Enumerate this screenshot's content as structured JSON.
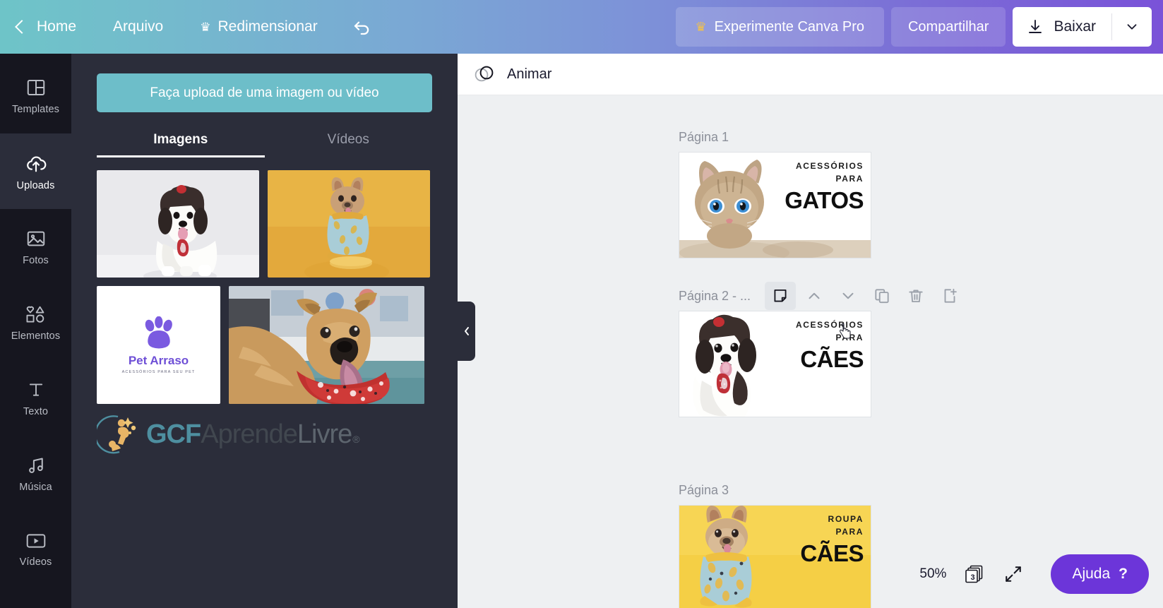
{
  "topbar": {
    "back_icon": "chevron-left-icon",
    "home_label": "Home",
    "file_label": "Arquivo",
    "resize_label": "Redimensionar",
    "resize_crown_icon": "crown-icon",
    "undo_icon": "undo-arrow-icon",
    "pro_label": "Experimente Canva Pro",
    "pro_crown_icon": "crown-icon",
    "share_label": "Compartilhar",
    "download_label": "Baixar",
    "download_icon": "download-arrow-icon",
    "download_caret_icon": "chevron-down-icon",
    "gradient_start": "#6ec4c8",
    "gradient_end": "#7a52d8"
  },
  "rail": {
    "items": [
      {
        "label": "Templates",
        "icon": "templates-grid-icon",
        "active": false
      },
      {
        "label": "Uploads",
        "icon": "cloud-upload-icon",
        "active": true
      },
      {
        "label": "Fotos",
        "icon": "photo-mountain-icon",
        "active": false
      },
      {
        "label": "Elementos",
        "icon": "shapes-icon",
        "active": false
      },
      {
        "label": "Texto",
        "icon": "text-t-icon",
        "active": false
      },
      {
        "label": "Música",
        "icon": "music-note-icon",
        "active": false
      },
      {
        "label": "Vídeos",
        "icon": "video-play-icon",
        "active": false
      }
    ]
  },
  "panel": {
    "upload_button_label": "Faça upload de uma imagem ou vídeo",
    "upload_button_color": "#6dbec9",
    "tabs": [
      {
        "label": "Imagens",
        "active": true
      },
      {
        "label": "Vídeos",
        "active": false
      }
    ],
    "thumbnails": [
      {
        "name": "shih-tzu-dog-white-background",
        "alt": "Cão shih tzu preto e branco em fundo claro"
      },
      {
        "name": "french-bulldog-yellow-background",
        "alt": "Buldogue francês com camiseta em fundo amarelo"
      },
      {
        "name": "pet-arraso-logo",
        "alt": "Logotipo Pet Arraso",
        "logo_title": "Pet Arraso",
        "logo_subtitle": "ACESSÓRIOS PARA SEU PET"
      },
      {
        "name": "dog-with-red-bandana",
        "alt": "Cão com bandana vermelha"
      }
    ],
    "footer_logo": {
      "brand_bold": "GCF",
      "brand_mid": "Aprende",
      "brand_light": "Livre",
      "registered": "®"
    }
  },
  "canvas": {
    "animar_label": "Animar",
    "animar_icon": "animate-circles-icon",
    "collapse_icon": "chevron-left-icon",
    "pages": [
      {
        "title": "Página 1",
        "selected": false,
        "art": {
          "line1": "ACESSÓRIOS",
          "line2": "PARA",
          "headline": "GATOS",
          "bg": "#ffffff",
          "subject": "cat-photo"
        }
      },
      {
        "title": "Página 2 - ...",
        "selected": true,
        "art": {
          "line1": "ACESSÓRIOS",
          "line2": "PARA",
          "headline": "CÃES",
          "bg": "#ffffff",
          "subject": "shih-tzu-photo"
        }
      },
      {
        "title": "Página 3",
        "selected": false,
        "art": {
          "line1": "ROUPA",
          "line2": "PARA",
          "headline": "CÃES",
          "bg": "#f5cf45",
          "subject": "french-bulldog-photo"
        }
      }
    ],
    "page_tools": [
      {
        "name": "notes-page-icon",
        "active": true
      },
      {
        "name": "move-up-icon",
        "active": false
      },
      {
        "name": "move-down-icon",
        "active": false
      },
      {
        "name": "duplicate-icon",
        "active": false
      },
      {
        "name": "delete-trash-icon",
        "active": false
      },
      {
        "name": "add-page-icon",
        "active": false
      }
    ]
  },
  "bottom": {
    "zoom_level": "50%",
    "page_count": "3",
    "page_count_icon": "pages-stack-icon",
    "fullscreen_icon": "expand-diagonal-icon",
    "help_label": "Ajuda",
    "help_question": "?",
    "help_color": "#6c35d9"
  }
}
